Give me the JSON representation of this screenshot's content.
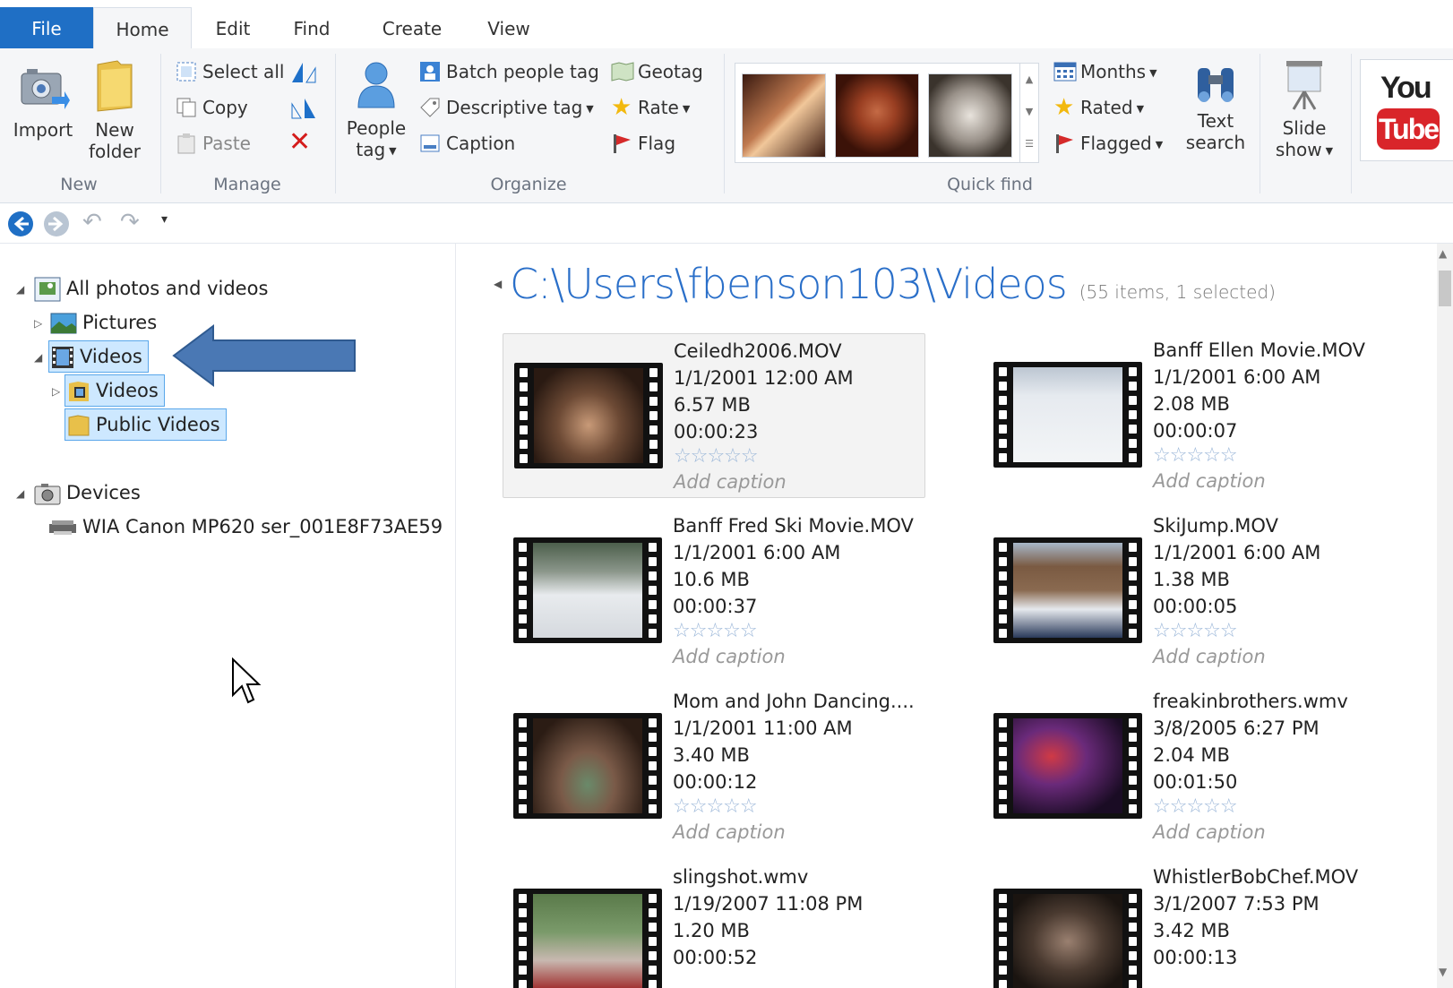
{
  "tabs": [
    "File",
    "Home",
    "Edit",
    "Find",
    "Create",
    "View"
  ],
  "ribbon": {
    "new": {
      "import": "Import",
      "new_folder_1": "New",
      "new_folder_2": "folder",
      "label": "New"
    },
    "manage": {
      "select_all": "Select all",
      "copy": "Copy",
      "paste": "Paste",
      "label": "Manage"
    },
    "organize": {
      "people_tag_1": "People",
      "people_tag_2": "tag",
      "batch_people_tag": "Batch people tag",
      "descriptive_tag": "Descriptive tag",
      "caption": "Caption",
      "geotag": "Geotag",
      "rate": "Rate",
      "flag": "Flag",
      "label": "Organize"
    },
    "quickfind": {
      "months": "Months",
      "rated": "Rated",
      "flagged": "Flagged",
      "text_search_1": "Text",
      "text_search_2": "search",
      "label": "Quick find"
    },
    "slideshow_1": "Slide",
    "slideshow_2": "show",
    "youtube_1": "You",
    "youtube_2": "Tube"
  },
  "nav": {
    "all_photos": "All photos and videos",
    "pictures": "Pictures",
    "videos": "Videos",
    "videos_sub": "Videos",
    "public_videos": "Public Videos",
    "devices": "Devices",
    "device_1": "WIA Canon MP620 ser_001E8F73AE59"
  },
  "content": {
    "path": "C:\\Users\\fbenson103\\Videos",
    "count": "(55 items, 1 selected)",
    "items": [
      {
        "name": "Ceiledh2006.MOV",
        "date": "1/1/2001 12:00 AM",
        "size": "6.57 MB",
        "duration": "00:00:23",
        "stars": "☆☆☆☆☆",
        "caption": "Add caption"
      },
      {
        "name": "Banff Ellen Movie.MOV",
        "date": "1/1/2001 6:00 AM",
        "size": "2.08 MB",
        "duration": "00:00:07",
        "stars": "☆☆☆☆☆",
        "caption": "Add caption"
      },
      {
        "name": "Banff Fred Ski Movie.MOV",
        "date": "1/1/2001 6:00 AM",
        "size": "10.6 MB",
        "duration": "00:00:37",
        "stars": "☆☆☆☆☆",
        "caption": "Add caption"
      },
      {
        "name": "SkiJump.MOV",
        "date": "1/1/2001 6:00 AM",
        "size": "1.38 MB",
        "duration": "00:00:05",
        "stars": "☆☆☆☆☆",
        "caption": "Add caption"
      },
      {
        "name": "Mom and John Dancing....",
        "date": "1/1/2001 11:00 AM",
        "size": "3.40 MB",
        "duration": "00:00:12",
        "stars": "☆☆☆☆☆",
        "caption": "Add caption"
      },
      {
        "name": "freakinbrothers.wmv",
        "date": "3/8/2005 6:27 PM",
        "size": "2.04 MB",
        "duration": "00:01:50",
        "stars": "☆☆☆☆☆",
        "caption": "Add caption"
      },
      {
        "name": "slingshot.wmv",
        "date": "1/19/2007 11:08 PM",
        "size": "1.20 MB",
        "duration": "00:00:52",
        "stars": "",
        "caption": ""
      },
      {
        "name": "WhistlerBobChef.MOV",
        "date": "3/1/2007 7:53 PM",
        "size": "3.42 MB",
        "duration": "00:00:13",
        "stars": "",
        "caption": ""
      }
    ]
  },
  "colors": {
    "accent": "#1f6fc5",
    "path": "#2a6fc9",
    "arrow": "#4a78b4",
    "selection": "#cde8ff"
  }
}
